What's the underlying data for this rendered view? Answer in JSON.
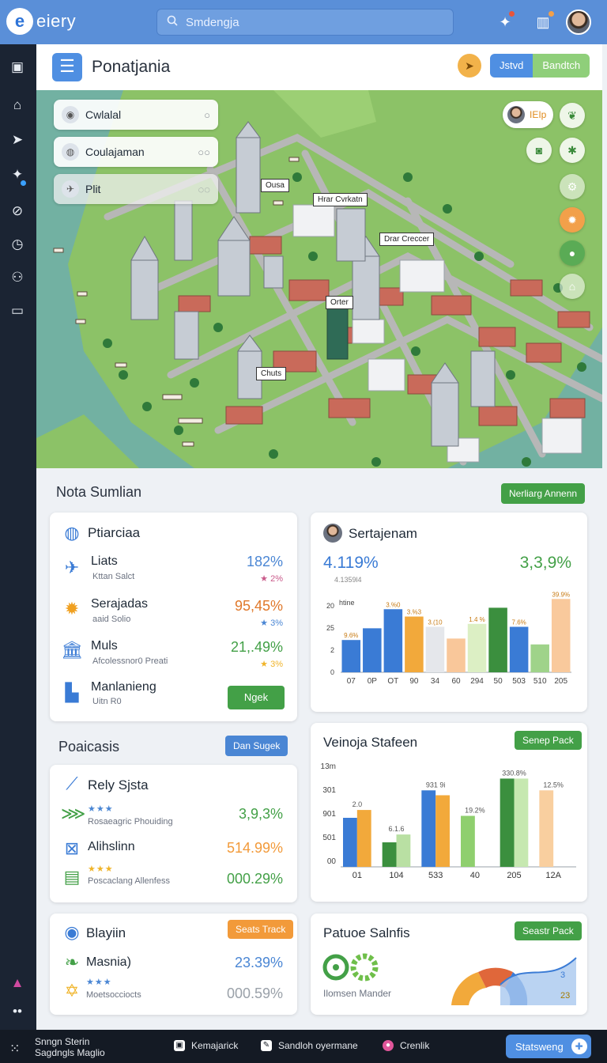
{
  "app": {
    "logo_letter": "e",
    "logo_text": "eiery"
  },
  "search": {
    "value": "Smdengja"
  },
  "header": {
    "title": "Ponatjania",
    "seg_left": "Jstvd",
    "seg_right": "Bandtch"
  },
  "map": {
    "layers": [
      {
        "label": "Cwlalal",
        "toggle": "○"
      },
      {
        "label": "Coulajaman",
        "toggle": "○○"
      },
      {
        "label": "Plit",
        "toggle": "◌◌"
      }
    ],
    "labels": [
      "Ousa",
      "Hrar Cvrkatn",
      "Drar Creccer",
      "Orter",
      "Chuts"
    ],
    "user_chip": "IEIp"
  },
  "summary": {
    "title": "Nota Sumlian",
    "button": "Nerliarg Annenn",
    "left_card": {
      "title": "Ptiarciaa",
      "rows": [
        {
          "label": "Liats",
          "sub": "Kttan Salct",
          "value": "182%",
          "delta": "2%",
          "color": "#4a86d4"
        },
        {
          "label": "Serajadas",
          "sub": "aaid Solio",
          "value": "95,45%",
          "delta": "3%",
          "color": "#e0782a"
        },
        {
          "label": "Muls",
          "sub": "Afcolessnor0 Preati",
          "value": "21,.49%",
          "delta": "3%",
          "color": "#43a047"
        },
        {
          "label": "Manlanieng",
          "sub": "Uitn R0",
          "value": "",
          "delta": "",
          "color": "#43a047"
        }
      ],
      "button": "Ngek"
    },
    "chart_card": {
      "title": "Sertajenam",
      "big_left": "4.119%",
      "big_right": "3,3,9%"
    }
  },
  "lower": {
    "left_title": "Poaicasis",
    "left_button": "Dan Sugek",
    "card2": {
      "title": "Rely Sjsta",
      "rows": [
        {
          "label": "",
          "sub": "Rosaeagric Phouiding",
          "value": "3,9,3%",
          "color": "#43a047"
        },
        {
          "label": "Alihslinn",
          "sub": "Poscaclang Allenfess",
          "value": "514.99%",
          "value2": "000.29%",
          "color": "#f29a3a"
        }
      ]
    },
    "card3": {
      "title": "Veinoja Stafeen",
      "button": "Senep Pack"
    },
    "card4": {
      "title": "Blayiin",
      "button": "Seats Track",
      "rows": [
        {
          "label": "Masnia)",
          "value": "23.39%"
        },
        {
          "label": "",
          "sub": "Moetsocciocts",
          "value": "000.59%"
        }
      ]
    },
    "card5": {
      "title": "Patuoe Salnfis",
      "button": "Seastr Pack",
      "sub": "Ilomsen Mander",
      "v1": "3",
      "v2": "23"
    }
  },
  "bottombar": {
    "left_line1": "Snngn Sterin",
    "left_line2": "Sagdngls Maglio",
    "items": [
      "Kemajarick",
      "Sandloh oyermane",
      "Crenlik"
    ],
    "stat_button": "Statsweng"
  },
  "chart_data": [
    {
      "type": "bar",
      "title": "Sertajenam",
      "categories": [
        "07",
        "0P",
        "OT",
        "90",
        "34",
        "60",
        "294",
        "50",
        "503",
        "510",
        "205"
      ],
      "values": [
        22,
        30,
        43,
        38,
        31,
        23,
        33,
        44,
        31,
        19,
        50
      ],
      "colors": [
        "#3a7bd5",
        "#3a7bd5",
        "#3a7bd5",
        "#f2a93b",
        "#e5e7eb",
        "#f9c79a",
        "#dcefc4",
        "#3b8f3e",
        "#3a7bd5",
        "#9fd38a",
        "#f9c99c"
      ],
      "bar_labels": [
        "9.6%",
        "",
        "3.%0",
        "3.%3",
        "3.(10",
        "",
        "1.4 %",
        "",
        "7.6%",
        "",
        "39.9%"
      ],
      "y_ticks": [
        "0",
        "2",
        "25",
        "20"
      ],
      "annotations": [
        "4.1359l4",
        "htine"
      ],
      "ylim": [
        0,
        55
      ]
    },
    {
      "type": "bar",
      "title": "Veinoja Stafeen",
      "categories": [
        "01",
        "104",
        "533",
        "40",
        "205",
        "12A"
      ],
      "series": [
        {
          "values": [
            50,
            25,
            78,
            52,
            90,
            78
          ]
        },
        {
          "values": [
            58,
            33,
            73,
            0,
            90,
            0
          ]
        }
      ],
      "colors": [
        [
          "#3a7bd5",
          "#f2a93b"
        ],
        [
          "#3b8f3e",
          "#b9e0a3"
        ],
        [
          "#3a7bd5",
          "#f2a93b"
        ],
        [
          "#8fcf6e",
          "#8fcf6e"
        ],
        [
          "#3b8f3e",
          "#c6e8b0"
        ],
        [
          "#f9cf9f",
          "#f9cf9f"
        ]
      ],
      "bar_labels": [
        "2.0",
        "6.1.6",
        "931  9i",
        "19.2%",
        "330.8%",
        "12.5%"
      ],
      "y_ticks": [
        "13m",
        "301",
        "901",
        "501",
        "00"
      ],
      "ylim": [
        0,
        100
      ]
    }
  ]
}
